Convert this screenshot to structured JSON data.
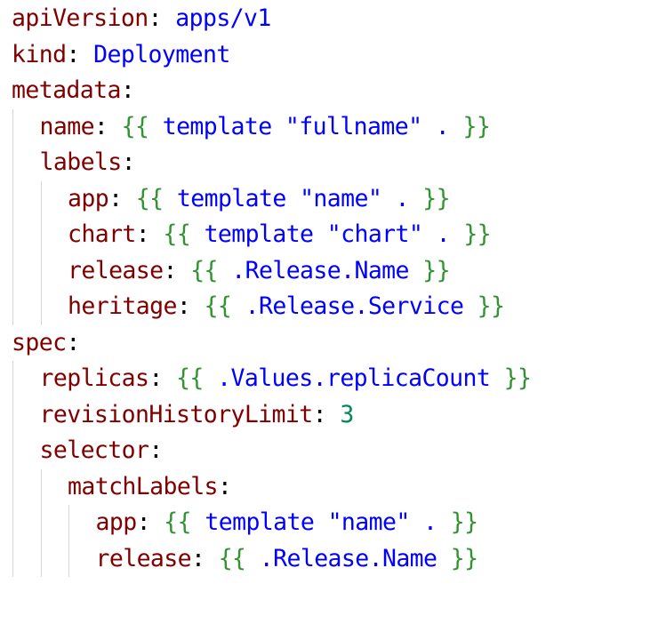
{
  "editor": {
    "language": "yaml",
    "lines": [
      {
        "indent": 0,
        "key": "apiVersion",
        "value": "apps/v1",
        "value_kind": "string"
      },
      {
        "indent": 0,
        "key": "kind",
        "value": "Deployment",
        "value_kind": "string"
      },
      {
        "indent": 0,
        "key": "metadata"
      },
      {
        "indent": 1,
        "key": "name",
        "template": "template \"fullname\" .",
        "value_kind": "template"
      },
      {
        "indent": 1,
        "key": "labels"
      },
      {
        "indent": 2,
        "key": "app",
        "template": "template \"name\" .",
        "value_kind": "template"
      },
      {
        "indent": 2,
        "key": "chart",
        "template": "template \"chart\" .",
        "value_kind": "template"
      },
      {
        "indent": 2,
        "key": "release",
        "template": ".Release.Name",
        "value_kind": "template"
      },
      {
        "indent": 2,
        "key": "heritage",
        "template": ".Release.Service",
        "value_kind": "template"
      },
      {
        "indent": 0,
        "key": "spec"
      },
      {
        "indent": 1,
        "key": "replicas",
        "template": ".Values.replicaCount",
        "value_kind": "template"
      },
      {
        "indent": 1,
        "key": "revisionHistoryLimit",
        "value": "3",
        "value_kind": "number"
      },
      {
        "indent": 1,
        "key": "selector"
      },
      {
        "indent": 2,
        "key": "matchLabels"
      },
      {
        "indent": 3,
        "key": "app",
        "template": "template \"name\" .",
        "value_kind": "template"
      },
      {
        "indent": 3,
        "key": "release",
        "template": ".Release.Name",
        "value_kind": "template"
      }
    ],
    "colors": {
      "key": "#800000",
      "string_value": "#0000ff",
      "number_value": "#098658",
      "template_brace": "#319331",
      "template_body": "#0000ff",
      "indent_guide": "#d4d4d4",
      "background": "#ffffff"
    }
  }
}
